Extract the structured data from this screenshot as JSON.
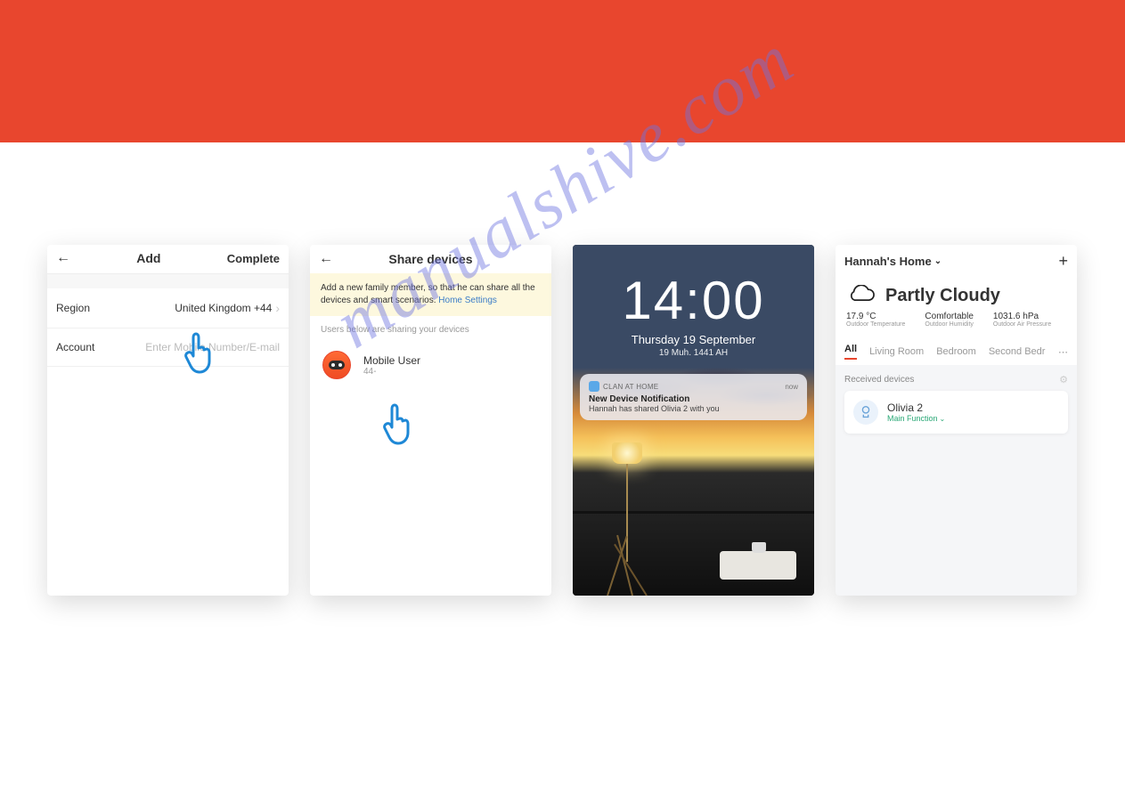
{
  "watermark": "manualshive.com",
  "screen1": {
    "title": "Add",
    "complete": "Complete",
    "region_label": "Region",
    "region_value": "United Kingdom +44",
    "account_label": "Account",
    "account_placeholder": "Enter Mobile Number/E-mail"
  },
  "screen2": {
    "title": "Share devices",
    "tip_text": "Add a new family member, so that he can share all the devices and smart scenarios.",
    "tip_link": "Home Settings",
    "subheading": "Users below are sharing your devices",
    "user_name": "Mobile User",
    "user_sub": "44-"
  },
  "screen3": {
    "time": "14:00",
    "date": "Thursday 19 September",
    "date2": "19 Muh. 1441 AH",
    "notif_app": "CLAN AT HOME",
    "notif_when": "now",
    "notif_title": "New Device Notification",
    "notif_body": "Hannah has shared Olivia 2 with you"
  },
  "screen4": {
    "home_name": "Hannah's Home",
    "weather_title": "Partly Cloudy",
    "stats": [
      {
        "value": "17.9 °C",
        "label": "Outdoor Temperature"
      },
      {
        "value": "Comfortable",
        "label": "Outdoor Humidity"
      },
      {
        "value": "1031.6 hPa",
        "label": "Outdoor Air Pressure"
      }
    ],
    "tabs": [
      "All",
      "Living Room",
      "Bedroom",
      "Second Bedroom"
    ],
    "section": "Received devices",
    "device_name": "Olivia 2",
    "device_sub": "Main Function"
  }
}
